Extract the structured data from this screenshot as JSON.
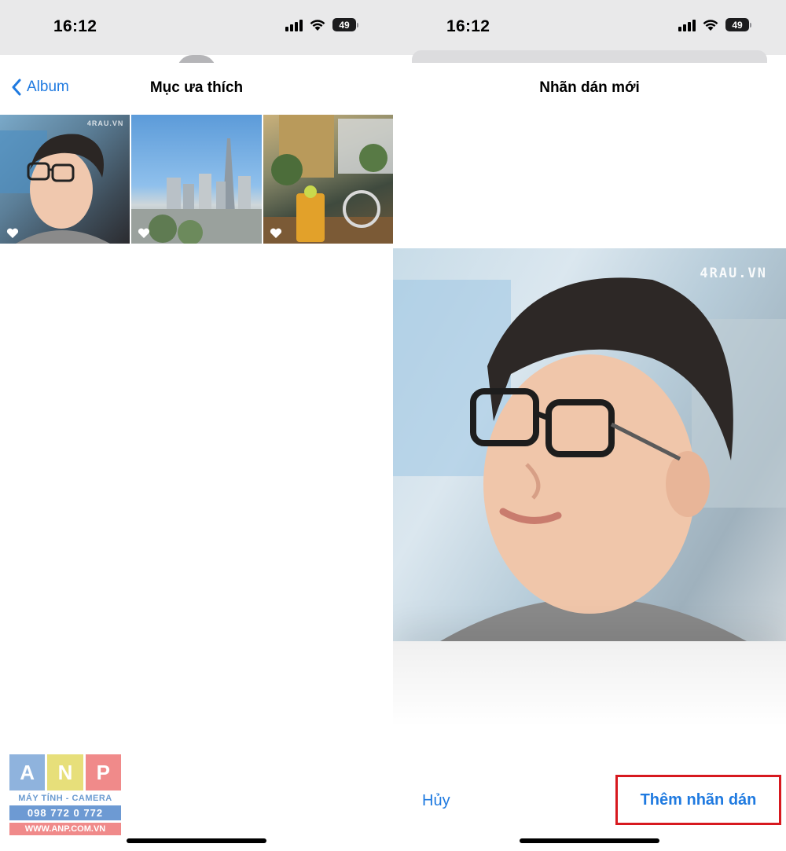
{
  "left_screen": {
    "status": {
      "time": "16:12",
      "battery": "49"
    },
    "nav": {
      "back_label": "Album",
      "title": "Mục ưa thích"
    },
    "photos": [
      {
        "name": "portrait",
        "watermark": "4RAU.VN",
        "favorite": true
      },
      {
        "name": "city-skyline",
        "favorite": true
      },
      {
        "name": "cafe-drink",
        "favorite": true
      }
    ],
    "logo": {
      "letters": [
        "A",
        "N",
        "P"
      ],
      "tagline": "MÁY TÍNH - CAMERA",
      "phone": "098 772 0 772",
      "website": "WWW.ANP.COM.VN"
    }
  },
  "right_screen": {
    "status": {
      "time": "16:12",
      "battery": "49"
    },
    "title": "Nhãn dán mới",
    "preview_watermark": "4RAU.VN",
    "cancel_label": "Hủy",
    "add_label": "Thêm nhãn dán"
  },
  "colors": {
    "accent": "#1f7ae0",
    "highlight_border": "#d7191f"
  }
}
